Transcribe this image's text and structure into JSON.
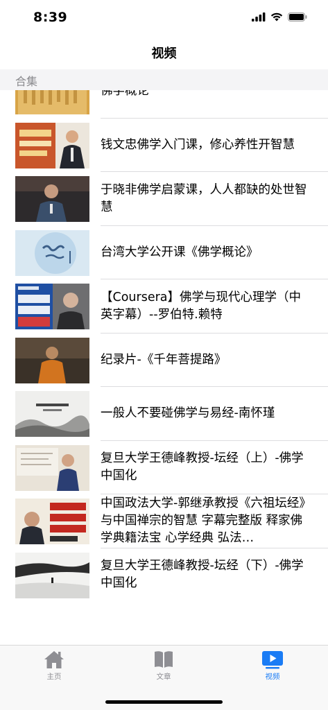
{
  "status": {
    "time": "8:39"
  },
  "nav": {
    "title": "视频"
  },
  "section": {
    "title": "合集"
  },
  "items": [
    {
      "title": "佛学概论",
      "thumb": "scroll"
    },
    {
      "title": "钱文忠佛学入门课，修心养性开智慧",
      "thumb": "lecturer-poster"
    },
    {
      "title": "于晓非佛学启蒙课，人人都缺的处世智慧",
      "thumb": "speaker-dark"
    },
    {
      "title": "台湾大学公开课《佛学概论》",
      "thumb": "calligraphy-blue"
    },
    {
      "title": "【Coursera】佛学与现代心理学（中英字幕）--罗伯特.赖特",
      "thumb": "coursera"
    },
    {
      "title": "纪录片-《千年菩提路》",
      "thumb": "monk"
    },
    {
      "title": "一般人不要碰佛学与易经-南怀瑾",
      "thumb": "ink-landscape"
    },
    {
      "title": "复旦大学王德峰教授-坛经（上）-佛学中国化",
      "thumb": "classroom"
    },
    {
      "title": "中国政法大学-郭继承教授《六祖坛经》与中国禅宗的智慧 字幕完整版 释家佛学典籍法宝 心学经典 弘法…",
      "thumb": "liuzu"
    },
    {
      "title": "复旦大学王德峰教授-坛经（下）-佛学中国化",
      "thumb": "ink-road"
    }
  ],
  "tabs": [
    {
      "label": "主页",
      "icon": "house-icon",
      "active": false
    },
    {
      "label": "文章",
      "icon": "book-icon",
      "active": false
    },
    {
      "label": "视频",
      "icon": "play-icon",
      "active": true
    }
  ],
  "colors": {
    "accent": "#1a7cf5",
    "inactive": "#8e8e93",
    "header_bg": "#f4f4f6",
    "separator": "#dcdcdf"
  }
}
